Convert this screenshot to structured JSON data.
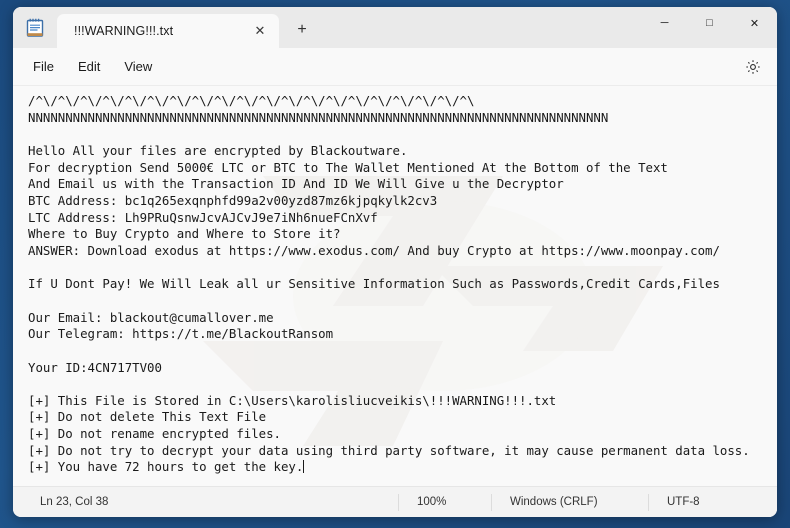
{
  "window": {
    "app_icon": "notepad-icon",
    "controls": {
      "minimize": "─",
      "maximize": "□",
      "close": "✕"
    }
  },
  "tabs": [
    {
      "title": "!!!WARNING!!!.txt",
      "close_glyph": "✕",
      "active": true
    }
  ],
  "new_tab": {
    "label": "+"
  },
  "menubar": {
    "items": [
      {
        "label": "File"
      },
      {
        "label": "Edit"
      },
      {
        "label": "View"
      }
    ],
    "settings_icon": "gear-icon"
  },
  "editor": {
    "text": "/^\\/^\\/^\\/^\\/^\\/^\\/^\\/^\\/^\\/^\\/^\\/^\\/^\\/^\\/^\\/^\\/^\\/^\\/^\\/^\\\nNNNNNNNNNNNNNNNNNNNNNNNNNNNNNNNNNNNNNNNNNNNNNNNNNNNNNNNNNNNNNNNNNNNNNNNNNNNNNN\n\nHello All your files are encrypted by Blackoutware.\nFor decryption Send 5000€ LTC or BTC to The Wallet Mentioned At the Bottom of the Text\nAnd Email us with the Transaction ID And ID We Will Give u the Decryptor\nBTC Address: bc1q265exqnphfd99a2v00yzd87mz6kjpqkylk2cv3\nLTC Address: Lh9PRuQsnwJcvAJCvJ9e7iNh6nueFCnXvf\nWhere to Buy Crypto and Where to Store it?\nANSWER: Download exodus at https://www.exodus.com/ And buy Crypto at https://www.moonpay.com/\n\nIf U Dont Pay! We Will Leak all ur Sensitive Information Such as Passwords,Credit Cards,Files\n\nOur Email: blackout@cumallover.me\nOur Telegram: https://t.me/BlackoutRansom\n\nYour ID:4CN717TV00\n\n[+] This File is Stored in C:\\Users\\karolisliucveikis\\!!!WARNING!!!.txt\n[+] Do not delete This Text File\n[+] Do not rename encrypted files.\n[+] Do not try to decrypt your data using third party software, it may cause permanent data loss.\n[+] You have 72 hours to get the key.",
    "caret_visible": true
  },
  "statusbar": {
    "position": "Ln 23, Col 38",
    "zoom": "100%",
    "line_ending": "Windows (CRLF)",
    "encoding": "UTF-8"
  },
  "colors": {
    "desktop": "#1f4f82",
    "window_bg": "#f9f9f9",
    "titlebar_bg": "#eaeaea",
    "text": "#1a1a1a",
    "status_bg": "#f3f3f3"
  }
}
